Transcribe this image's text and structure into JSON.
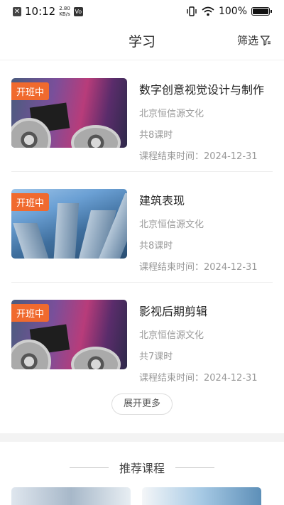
{
  "status_bar": {
    "time": "10:12",
    "speed_value": "2.80",
    "speed_unit": "KB/s",
    "vo_label": "Vo",
    "battery": "100%"
  },
  "header": {
    "title": "学习",
    "filter_label": "筛选"
  },
  "courses": [
    {
      "badge": "开班中",
      "title": "数字创意视觉设计与制作",
      "provider": "北京恒信源文化",
      "lessons": "共8课时",
      "end_date": "课程结束时间：2024-12-31",
      "image": "film-reel"
    },
    {
      "badge": "开班中",
      "title": "建筑表现",
      "provider": "北京恒信源文化",
      "lessons": "共8课时",
      "end_date": "课程结束时间：2024-12-31",
      "image": "skyscrapers"
    },
    {
      "badge": "开班中",
      "title": "影视后期剪辑",
      "provider": "北京恒信源文化",
      "lessons": "共7课时",
      "end_date": "课程结束时间：2024-12-31",
      "image": "film-reel"
    }
  ],
  "more_label": "展开更多",
  "recommend": {
    "title": "推荐课程"
  },
  "colors": {
    "badge": "#f06a2e",
    "meta_text": "#999999",
    "divider": "#eeeeee"
  }
}
